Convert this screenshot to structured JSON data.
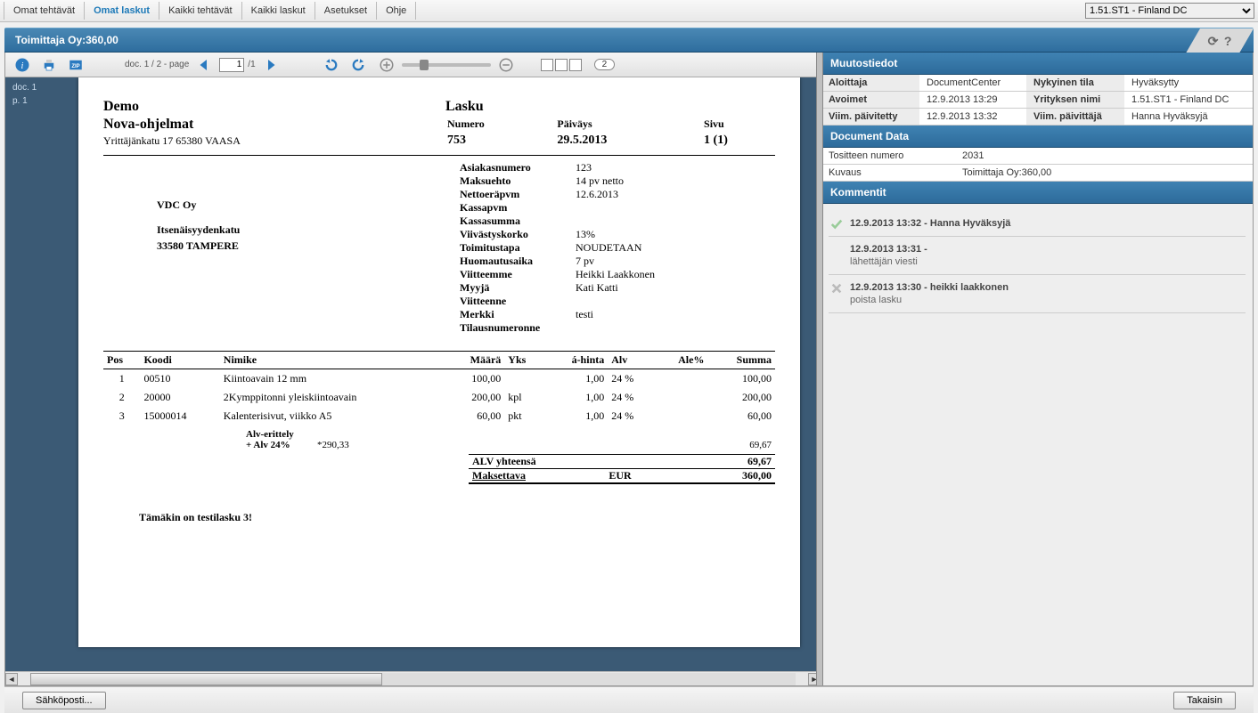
{
  "topbar": {
    "tabs": [
      "Omat tehtävät",
      "Omat laskut",
      "Kaikki tehtävät",
      "Kaikki laskut",
      "Asetukset",
      "Ohje"
    ],
    "active_index": 1,
    "env_select": "1.51.ST1 - Finland DC"
  },
  "title": "Toimittaja Oy:360,00",
  "toolbar": {
    "doc_label_prefix": "doc. ",
    "doc_current": "1",
    "doc_total": "2",
    "page_label": " - page ",
    "page_input": "1",
    "page_total": "/1",
    "doc_count": "2"
  },
  "thumbs": {
    "doc": "doc. 1",
    "page": "p. 1"
  },
  "invoice": {
    "demo": "Demo",
    "program": "Nova-ohjelmat",
    "sender_addr": "Yrittäjänkatu 17 65380  VAASA",
    "title": "Lasku",
    "num_label": "Numero",
    "date_label": "Päiväys",
    "page_label": "Sivu",
    "num": "753",
    "date": "29.5.2013",
    "page": "1 (1)",
    "customer": {
      "name": "VDC Oy",
      "street": "Itsenäisyydenkatu",
      "city": "33580 TAMPERE"
    },
    "fields": [
      [
        "Asiakasnumero",
        "123"
      ],
      [
        "Maksuehto",
        "14 pv netto"
      ],
      [
        "Nettoeräpvm",
        "12.6.2013"
      ],
      [
        "Kassapvm",
        ""
      ],
      [
        "Kassasumma",
        ""
      ],
      [
        "Viivästyskorko",
        "13%"
      ],
      [
        "Toimitustapa",
        "NOUDETAAN"
      ],
      [
        "Huomautusaika",
        "7 pv"
      ],
      [
        "Viitteemme",
        "Heikki Laakkonen"
      ],
      [
        "Myyjä",
        "Kati Katti"
      ],
      [
        "Viitteenne",
        ""
      ],
      [
        "Merkki",
        "testi"
      ],
      [
        "Tilausnumeronne",
        ""
      ]
    ],
    "cols": [
      "Pos",
      "Koodi",
      "Nimike",
      "Määrä",
      "Yks",
      "á-hinta",
      "Alv",
      "Ale%",
      "Summa"
    ],
    "lines": [
      {
        "pos": "1",
        "koodi": "00510",
        "nimike": "Kiintoavain 12 mm",
        "maara": "100,00",
        "yks": "",
        "ahinta": "1,00",
        "alv": "24 %",
        "ale": "",
        "summa": "100,00"
      },
      {
        "pos": "2",
        "koodi": "20000",
        "nimike": "2Kymppitonni yleiskiintoavain",
        "maara": "200,00",
        "yks": "kpl",
        "ahinta": "1,00",
        "alv": "24 %",
        "ale": "",
        "summa": "200,00"
      },
      {
        "pos": "3",
        "koodi": "15000014",
        "nimike": "Kalenterisivut, viikko A5",
        "maara": "60,00",
        "yks": "pkt",
        "ahinta": "1,00",
        "alv": "24 %",
        "ale": "",
        "summa": "60,00"
      }
    ],
    "alv_erit_label": "Alv-erittely",
    "alv_line_label": "+ Alv 24%",
    "alv_line_base": "*290,33",
    "alv_line_val": "69,67",
    "alv_total_label": "ALV yhteensä",
    "alv_total_val": "69,67",
    "pay_label": "Maksettava",
    "pay_cur": "EUR",
    "pay_val": "360,00",
    "note": "Tämäkin on testilasku 3!"
  },
  "side": {
    "muutos_title": "Muutostiedot",
    "meta": {
      "k1": "Aloittaja",
      "v1": "DocumentCenter",
      "k2": "Nykyinen tila",
      "v2": "Hyväksytty",
      "k3": "Avoimet",
      "v3": "12.9.2013 13:29",
      "k4": "Yrityksen nimi",
      "v4": "1.51.ST1 - Finland DC",
      "k5": "Viim. päivitetty",
      "v5": "12.9.2013 13:32",
      "k6": "Viim. päivittäjä",
      "v6": "Hanna Hyväksyjä"
    },
    "docdata_title": "Document Data",
    "docdata": {
      "k1": "Tositteen numero",
      "v1": "2031",
      "k2": "Kuvaus",
      "v2": "Toimittaja Oy:360,00"
    },
    "comments_title": "Kommentit",
    "comments": [
      {
        "head": "12.9.2013 13:32 - Hanna Hyväksyjä",
        "body": "",
        "icon": "check"
      },
      {
        "head": "12.9.2013 13:31 -",
        "body": "lähettäjän viesti",
        "icon": ""
      },
      {
        "head": "12.9.2013 13:30 - heikki laakkonen",
        "body": "poista lasku",
        "icon": "x"
      }
    ]
  },
  "bottom": {
    "email": "Sähköposti...",
    "back": "Takaisin"
  }
}
